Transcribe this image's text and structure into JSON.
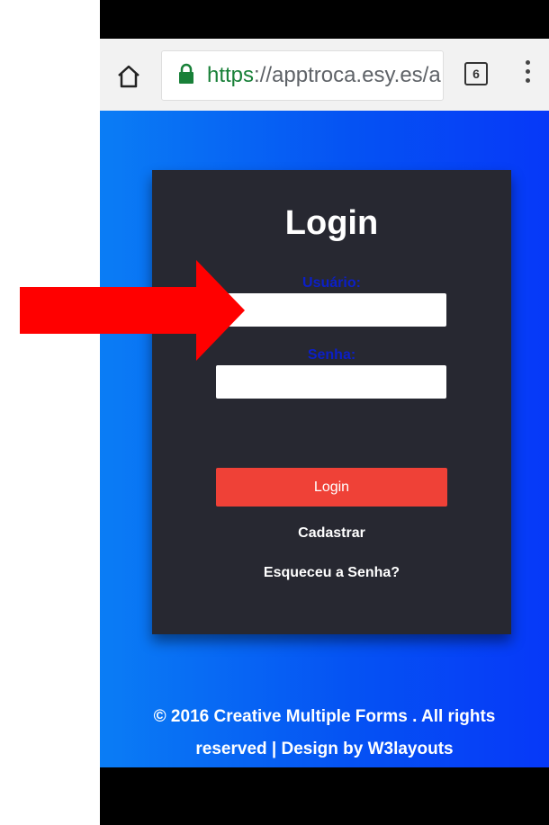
{
  "browser": {
    "url_scheme": "https",
    "url_rest": "://apptroca.esy.es/a",
    "tab_count": "6"
  },
  "login_card": {
    "title": "Login",
    "username_label": "Usuário:",
    "username_value": "",
    "password_label": "Senha:",
    "password_value": "",
    "login_button": "Login",
    "register_link": "Cadastrar",
    "forgot_link": "Esqueceu a Senha?"
  },
  "footer": {
    "line1": "© 2016 Creative Multiple Forms . All rights",
    "line2": "reserved | Design by W3layouts"
  },
  "colors": {
    "arrow": "#ff0000",
    "button": "#ef4137",
    "card": "#272831",
    "label": "#0b1fc8"
  },
  "icons": [
    "home-icon",
    "lock-icon",
    "tab-switcher-icon",
    "overflow-menu-icon",
    "red-arrow-annotation"
  ]
}
